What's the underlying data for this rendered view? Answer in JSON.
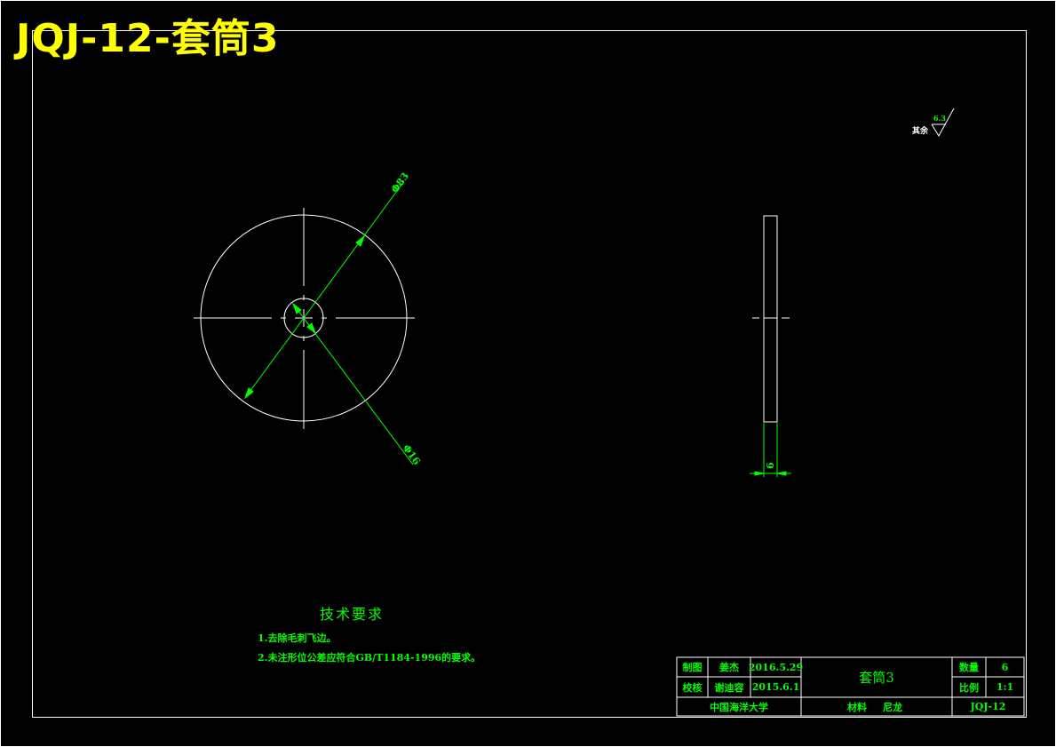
{
  "drawing": {
    "title": "JQJ-12-套筒3",
    "dimensions": {
      "outer_diameter": "Φ83",
      "inner_diameter": "Φ16",
      "thickness": "6"
    },
    "surface_finish": {
      "prefix": "其余",
      "value": "6.3"
    },
    "colors": {
      "title": "#ffff00",
      "annotation": "#00ff00",
      "geometry": "#ffffff"
    }
  },
  "tech_requirements": {
    "heading": "技术要求",
    "items": [
      "1.去除毛刺飞边。",
      "2.未注形位公差应符合GB/T1184-1996的要求。"
    ]
  },
  "title_block": {
    "drawn_label": "制图",
    "drawn_by": "姜杰",
    "drawn_date": "2016.5.29",
    "checked_label": "校核",
    "checked_by": "谢迪容",
    "checked_date": "2015.6.1",
    "part_name": "套筒3",
    "qty_label": "数量",
    "qty_value": "6",
    "scale_label": "比例",
    "scale_value": "1:1",
    "school": "中国海洋大学",
    "material_label": "材料",
    "material_value": "尼龙",
    "drawing_no": "JQJ-12"
  }
}
